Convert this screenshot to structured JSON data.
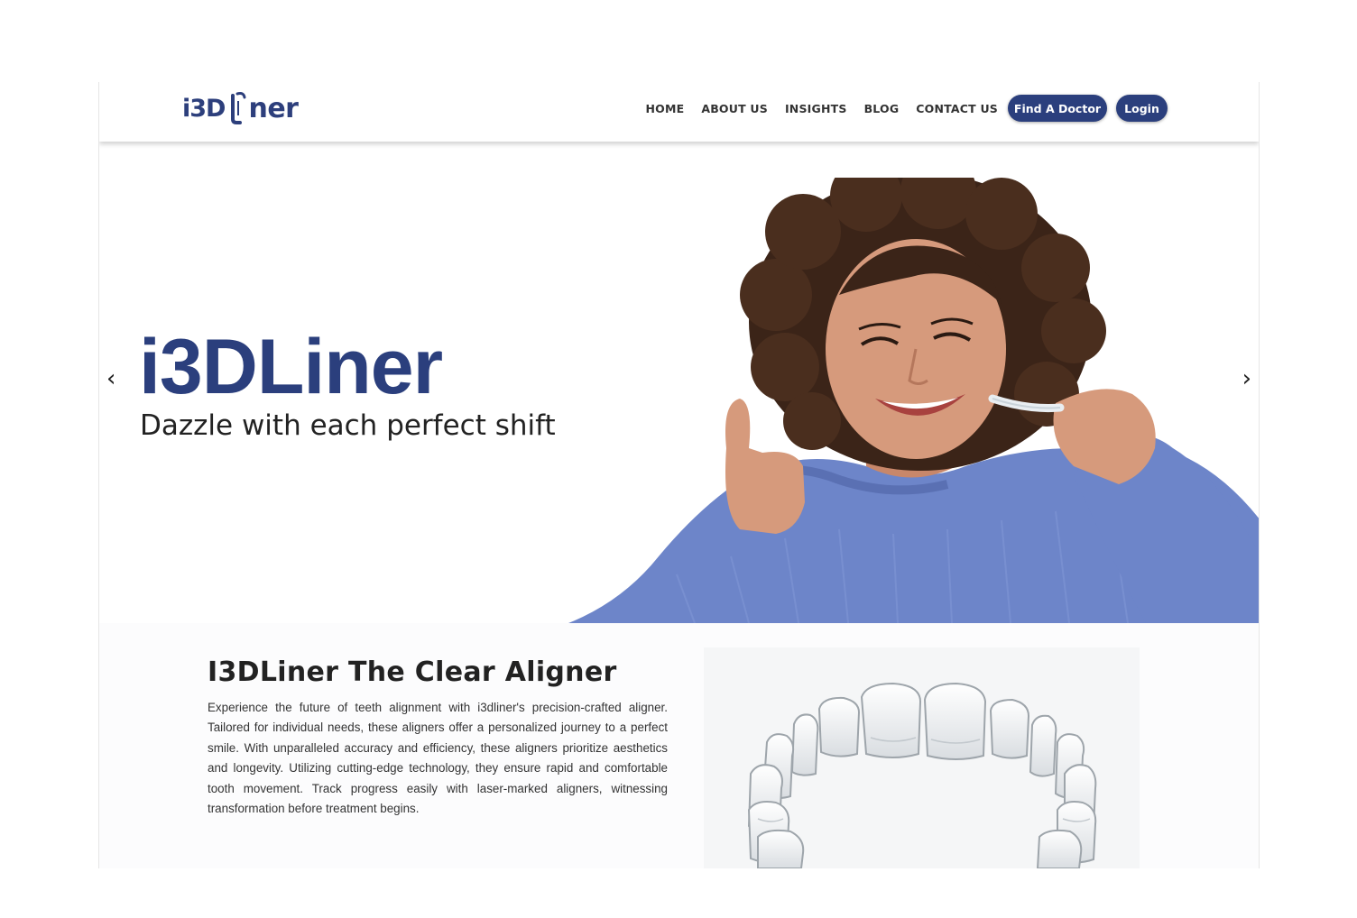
{
  "brand": {
    "logo_left": "i3D",
    "logo_right": "ner",
    "primary_color": "#2b3f7d"
  },
  "nav": {
    "items": [
      "HOME",
      "ABOUT US",
      "INSIGHTS",
      "BLOG",
      "CONTACT US"
    ],
    "find_doctor": "Find A Doctor",
    "login": "Login"
  },
  "hero": {
    "title": "i3DLiner",
    "subtitle": "Dazzle with each perfect shift",
    "prev_icon": "chevron-left-icon",
    "next_icon": "chevron-right-icon",
    "prev_glyph": "‹",
    "next_glyph": "›"
  },
  "about": {
    "title": "I3DLiner The Clear Aligner",
    "body": "Experience the future of teeth alignment with i3dliner's precision-crafted aligner. Tailored for individual needs, these aligners offer a personalized journey to a perfect smile. With unparalleled accuracy and efficiency, these aligners prioritize aesthetics and longevity. Utilizing cutting-edge technology, they ensure rapid and comfortable tooth movement. Track progress easily with laser-marked aligners, witnessing transformation before treatment begins."
  }
}
